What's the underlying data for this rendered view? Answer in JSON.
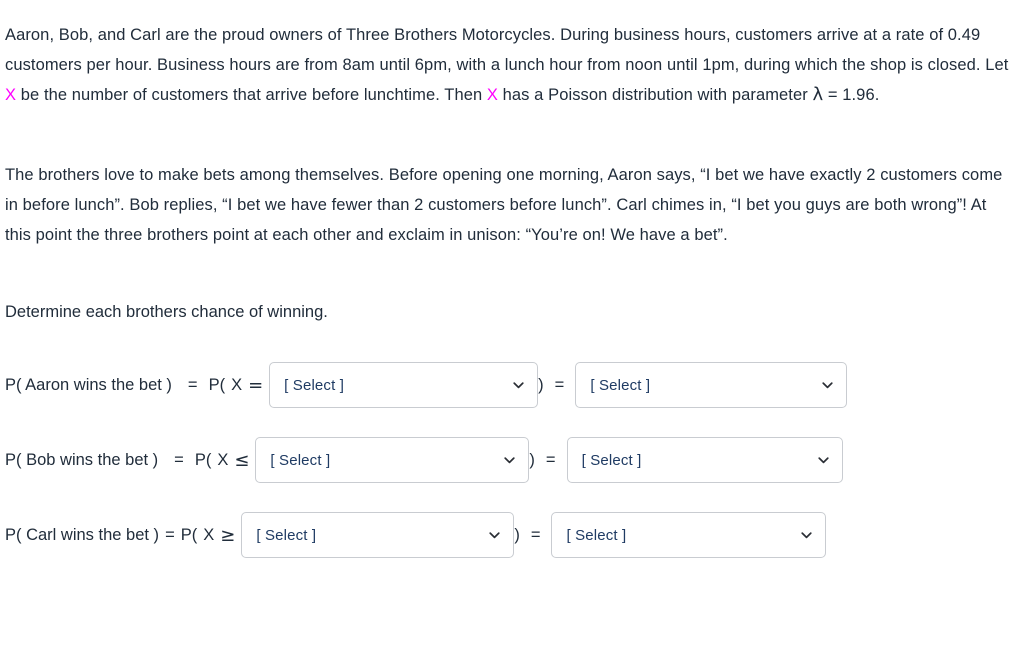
{
  "colors": {
    "variable_magenta": "#ff00ff",
    "text": "#212d3b",
    "select_border": "#c9ccd1",
    "select_text": "#1f3b63"
  },
  "problem": {
    "paragraph1": {
      "part_a": "Aaron, Bob, and Carl are the proud owners of Three Brothers Motorcycles.  During business hours, customers arrive at a rate of 0.49 customers per hour.  Business hours are from 8am until 6pm, with a lunch hour from noon until 1pm, during which the shop is closed.  Let ",
      "variable_1": "X",
      "part_b": " be the number of customers that arrive before lunchtime.  Then ",
      "variable_2": "X",
      "part_c": " has a Poisson distribution with parameter ",
      "lambda_symbol": "λ",
      "part_d": " = 1.96."
    },
    "paragraph2": "The brothers love to make bets among themselves.  Before opening one morning, Aaron says, “I bet we have exactly 2 customers come in before lunch”.  Bob replies, “I bet we have fewer than 2 customers before lunch”.  Carl chimes in, “I bet you guys are both wrong”!  At this point the three brothers point at each other and exclaim in unison: “You’re on!  We have a bet”.",
    "instruction": "Determine each brothers chance of winning."
  },
  "select_placeholder": "[ Select ]",
  "chevron_icon": "chevron-down-icon",
  "rows": [
    {
      "label": "P( Aaron wins the bet )",
      "equals_1": "=",
      "prob_open": "P(",
      "variable": "X",
      "relation": "=",
      "left_select_value": "[ Select ]",
      "paren_close": ")",
      "equals_2": "=",
      "right_select_value": "[ Select ]"
    },
    {
      "label": "P( Bob wins the bet )",
      "equals_1": "=",
      "prob_open": "P(",
      "variable": "X",
      "relation": "≤",
      "left_select_value": "[ Select ]",
      "paren_close": ")",
      "equals_2": "=",
      "right_select_value": "[ Select ]"
    },
    {
      "label": "P( Carl wins the bet )",
      "equals_1": "=",
      "prob_open": "P(",
      "variable": "X",
      "relation": "≥",
      "left_select_value": "[ Select ]",
      "paren_close": ")",
      "equals_2": "=",
      "right_select_value": "[ Select ]"
    }
  ]
}
